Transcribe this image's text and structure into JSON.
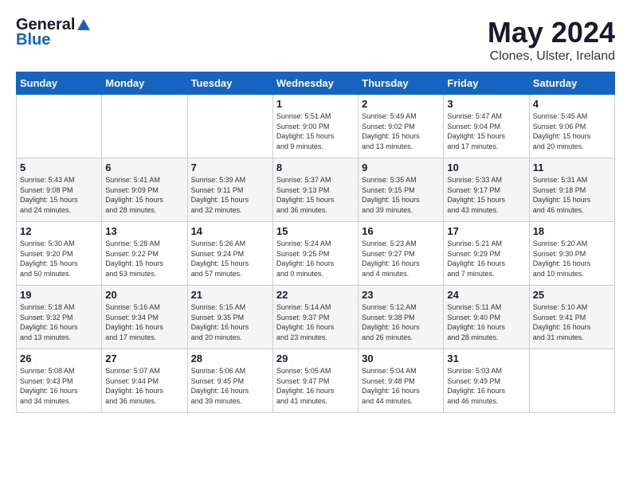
{
  "header": {
    "logo_general": "General",
    "logo_blue": "Blue",
    "month": "May 2024",
    "location": "Clones, Ulster, Ireland"
  },
  "weekdays": [
    "Sunday",
    "Monday",
    "Tuesday",
    "Wednesday",
    "Thursday",
    "Friday",
    "Saturday"
  ],
  "weeks": [
    [
      {
        "day": "",
        "info": ""
      },
      {
        "day": "",
        "info": ""
      },
      {
        "day": "",
        "info": ""
      },
      {
        "day": "1",
        "info": "Sunrise: 5:51 AM\nSunset: 9:00 PM\nDaylight: 15 hours\nand 9 minutes."
      },
      {
        "day": "2",
        "info": "Sunrise: 5:49 AM\nSunset: 9:02 PM\nDaylight: 15 hours\nand 13 minutes."
      },
      {
        "day": "3",
        "info": "Sunrise: 5:47 AM\nSunset: 9:04 PM\nDaylight: 15 hours\nand 17 minutes."
      },
      {
        "day": "4",
        "info": "Sunrise: 5:45 AM\nSunset: 9:06 PM\nDaylight: 15 hours\nand 20 minutes."
      }
    ],
    [
      {
        "day": "5",
        "info": "Sunrise: 5:43 AM\nSunset: 9:08 PM\nDaylight: 15 hours\nand 24 minutes."
      },
      {
        "day": "6",
        "info": "Sunrise: 5:41 AM\nSunset: 9:09 PM\nDaylight: 15 hours\nand 28 minutes."
      },
      {
        "day": "7",
        "info": "Sunrise: 5:39 AM\nSunset: 9:11 PM\nDaylight: 15 hours\nand 32 minutes."
      },
      {
        "day": "8",
        "info": "Sunrise: 5:37 AM\nSunset: 9:13 PM\nDaylight: 15 hours\nand 36 minutes."
      },
      {
        "day": "9",
        "info": "Sunrise: 5:35 AM\nSunset: 9:15 PM\nDaylight: 15 hours\nand 39 minutes."
      },
      {
        "day": "10",
        "info": "Sunrise: 5:33 AM\nSunset: 9:17 PM\nDaylight: 15 hours\nand 43 minutes."
      },
      {
        "day": "11",
        "info": "Sunrise: 5:31 AM\nSunset: 9:18 PM\nDaylight: 15 hours\nand 46 minutes."
      }
    ],
    [
      {
        "day": "12",
        "info": "Sunrise: 5:30 AM\nSunset: 9:20 PM\nDaylight: 15 hours\nand 50 minutes."
      },
      {
        "day": "13",
        "info": "Sunrise: 5:28 AM\nSunset: 9:22 PM\nDaylight: 15 hours\nand 53 minutes."
      },
      {
        "day": "14",
        "info": "Sunrise: 5:26 AM\nSunset: 9:24 PM\nDaylight: 15 hours\nand 57 minutes."
      },
      {
        "day": "15",
        "info": "Sunrise: 5:24 AM\nSunset: 9:25 PM\nDaylight: 16 hours\nand 0 minutes."
      },
      {
        "day": "16",
        "info": "Sunrise: 5:23 AM\nSunset: 9:27 PM\nDaylight: 16 hours\nand 4 minutes."
      },
      {
        "day": "17",
        "info": "Sunrise: 5:21 AM\nSunset: 9:29 PM\nDaylight: 16 hours\nand 7 minutes."
      },
      {
        "day": "18",
        "info": "Sunrise: 5:20 AM\nSunset: 9:30 PM\nDaylight: 16 hours\nand 10 minutes."
      }
    ],
    [
      {
        "day": "19",
        "info": "Sunrise: 5:18 AM\nSunset: 9:32 PM\nDaylight: 16 hours\nand 13 minutes."
      },
      {
        "day": "20",
        "info": "Sunrise: 5:16 AM\nSunset: 9:34 PM\nDaylight: 16 hours\nand 17 minutes."
      },
      {
        "day": "21",
        "info": "Sunrise: 5:15 AM\nSunset: 9:35 PM\nDaylight: 16 hours\nand 20 minutes."
      },
      {
        "day": "22",
        "info": "Sunrise: 5:14 AM\nSunset: 9:37 PM\nDaylight: 16 hours\nand 23 minutes."
      },
      {
        "day": "23",
        "info": "Sunrise: 5:12 AM\nSunset: 9:38 PM\nDaylight: 16 hours\nand 26 minutes."
      },
      {
        "day": "24",
        "info": "Sunrise: 5:11 AM\nSunset: 9:40 PM\nDaylight: 16 hours\nand 28 minutes."
      },
      {
        "day": "25",
        "info": "Sunrise: 5:10 AM\nSunset: 9:41 PM\nDaylight: 16 hours\nand 31 minutes."
      }
    ],
    [
      {
        "day": "26",
        "info": "Sunrise: 5:08 AM\nSunset: 9:43 PM\nDaylight: 16 hours\nand 34 minutes."
      },
      {
        "day": "27",
        "info": "Sunrise: 5:07 AM\nSunset: 9:44 PM\nDaylight: 16 hours\nand 36 minutes."
      },
      {
        "day": "28",
        "info": "Sunrise: 5:06 AM\nSunset: 9:45 PM\nDaylight: 16 hours\nand 39 minutes."
      },
      {
        "day": "29",
        "info": "Sunrise: 5:05 AM\nSunset: 9:47 PM\nDaylight: 16 hours\nand 41 minutes."
      },
      {
        "day": "30",
        "info": "Sunrise: 5:04 AM\nSunset: 9:48 PM\nDaylight: 16 hours\nand 44 minutes."
      },
      {
        "day": "31",
        "info": "Sunrise: 5:03 AM\nSunset: 9:49 PM\nDaylight: 16 hours\nand 46 minutes."
      },
      {
        "day": "",
        "info": ""
      }
    ]
  ]
}
